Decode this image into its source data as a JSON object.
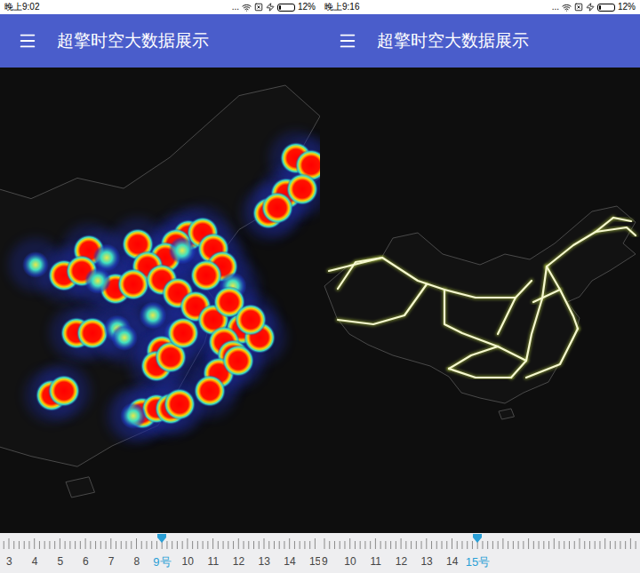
{
  "panels": [
    {
      "status_bar": {
        "time": "晚上9:02",
        "more": "...",
        "battery": "12%",
        "battery_level": 0.12
      },
      "app_bar": {
        "title": "超擎时空大数据展示"
      },
      "map": {
        "kind": "heatmap",
        "hotspots": [
          [
            333,
            102,
            1
          ],
          [
            350,
            110,
            1
          ],
          [
            322,
            142,
            1
          ],
          [
            340,
            137,
            1
          ],
          [
            302,
            164,
            1
          ],
          [
            312,
            158,
            1
          ],
          [
            212,
            189,
            1
          ],
          [
            228,
            186,
            1
          ],
          [
            198,
            199,
            1
          ],
          [
            186,
            214,
            1
          ],
          [
            240,
            204,
            1
          ],
          [
            250,
            224,
            1
          ],
          [
            232,
            234,
            1
          ],
          [
            205,
            206,
            0.6
          ],
          [
            100,
            206,
            1
          ],
          [
            120,
            214,
            0.6
          ],
          [
            155,
            199,
            1
          ],
          [
            166,
            224,
            1
          ],
          [
            40,
            222,
            0.5
          ],
          [
            72,
            234,
            1
          ],
          [
            92,
            229,
            1
          ],
          [
            130,
            249,
            1
          ],
          [
            150,
            244,
            1
          ],
          [
            110,
            240,
            0.5
          ],
          [
            182,
            239,
            1
          ],
          [
            200,
            254,
            1
          ],
          [
            220,
            269,
            1
          ],
          [
            240,
            284,
            1
          ],
          [
            262,
            246,
            0.6
          ],
          [
            258,
            264,
            1
          ],
          [
            86,
            299,
            1
          ],
          [
            104,
            299,
            1
          ],
          [
            132,
            294,
            0.6
          ],
          [
            172,
            279,
            0.6
          ],
          [
            200,
            299,
            0.6
          ],
          [
            140,
            304,
            0.5
          ],
          [
            272,
            294,
            1
          ],
          [
            292,
            304,
            1
          ],
          [
            282,
            284,
            1
          ],
          [
            252,
            309,
            1
          ],
          [
            262,
            324,
            1
          ],
          [
            246,
            344,
            1
          ],
          [
            236,
            364,
            1
          ],
          [
            268,
            330,
            1
          ],
          [
            182,
            319,
            1
          ],
          [
            176,
            336,
            1
          ],
          [
            192,
            326,
            1
          ],
          [
            206,
            299,
            1
          ],
          [
            58,
            369,
            1
          ],
          [
            72,
            364,
            1
          ],
          [
            160,
            389,
            1
          ],
          [
            176,
            384,
            0.8
          ],
          [
            192,
            384,
            1
          ],
          [
            202,
            379,
            1
          ],
          [
            150,
            392,
            0.5
          ]
        ]
      },
      "ruler": {
        "labels": [
          {
            "text": "3",
            "selected": false
          },
          {
            "text": "4",
            "selected": false
          },
          {
            "text": "5",
            "selected": false
          },
          {
            "text": "6",
            "selected": false
          },
          {
            "text": "7",
            "selected": false
          },
          {
            "text": "8",
            "selected": false
          },
          {
            "text": "9号",
            "selected": true
          },
          {
            "text": "10",
            "selected": false
          },
          {
            "text": "11",
            "selected": false
          },
          {
            "text": "12",
            "selected": false
          },
          {
            "text": "13",
            "selected": false
          },
          {
            "text": "14",
            "selected": false
          },
          {
            "text": "15",
            "selected": false
          }
        ]
      }
    },
    {
      "status_bar": {
        "time": "晚上9:16",
        "more": "...",
        "battery": "12%",
        "battery_level": 0.12
      },
      "app_bar": {
        "title": "超擎时空大数据展示"
      },
      "map": {
        "kind": "roads",
        "roads": [
          [
            [
              255,
              224
            ],
            [
              250,
              260
            ],
            [
              238,
              300
            ],
            [
              232,
              330
            ],
            [
              215,
              349
            ]
          ],
          [
            [
              255,
              224
            ],
            [
              270,
              250
            ],
            [
              285,
              280
            ],
            [
              290,
              294
            ]
          ],
          [
            [
              255,
              224
            ],
            [
              285,
              200
            ],
            [
              310,
              185
            ],
            [
              330,
              169
            ]
          ],
          [
            [
              310,
              185
            ],
            [
              345,
              180
            ],
            [
              355,
              189
            ]
          ],
          [
            [
              330,
              169
            ],
            [
              350,
              173
            ]
          ],
          [
            [
              220,
              259
            ],
            [
              175,
              259
            ],
            [
              140,
              250
            ],
            [
              110,
              240
            ],
            [
              70,
              214
            ],
            [
              40,
              219
            ],
            [
              20,
              249
            ]
          ],
          [
            [
              70,
              214
            ],
            [
              30,
              224
            ],
            [
              10,
              229
            ]
          ],
          [
            [
              120,
              244
            ],
            [
              95,
              279
            ],
            [
              60,
              289
            ],
            [
              20,
              284
            ]
          ],
          [
            [
              140,
              250
            ],
            [
              140,
              289
            ],
            [
              160,
              299
            ],
            [
              200,
              314
            ],
            [
              232,
              330
            ]
          ],
          [
            [
              290,
              294
            ],
            [
              270,
              334
            ],
            [
              232,
              349
            ]
          ],
          [
            [
              145,
              339
            ],
            [
              170,
              324
            ],
            [
              200,
              314
            ]
          ],
          [
            [
              145,
              339
            ],
            [
              175,
              349
            ],
            [
              215,
              349
            ]
          ],
          [
            [
              200,
              300
            ],
            [
              220,
              259
            ],
            [
              238,
              240
            ]
          ],
          [
            [
              270,
              250
            ],
            [
              240,
              264
            ]
          ]
        ]
      },
      "ruler": {
        "labels": [
          {
            "text": "9",
            "selected": false
          },
          {
            "text": "10",
            "selected": false
          },
          {
            "text": "11",
            "selected": false
          },
          {
            "text": "12",
            "selected": false
          },
          {
            "text": "13",
            "selected": false
          },
          {
            "text": "14",
            "selected": false
          },
          {
            "text": "15号",
            "selected": true
          }
        ]
      }
    }
  ]
}
